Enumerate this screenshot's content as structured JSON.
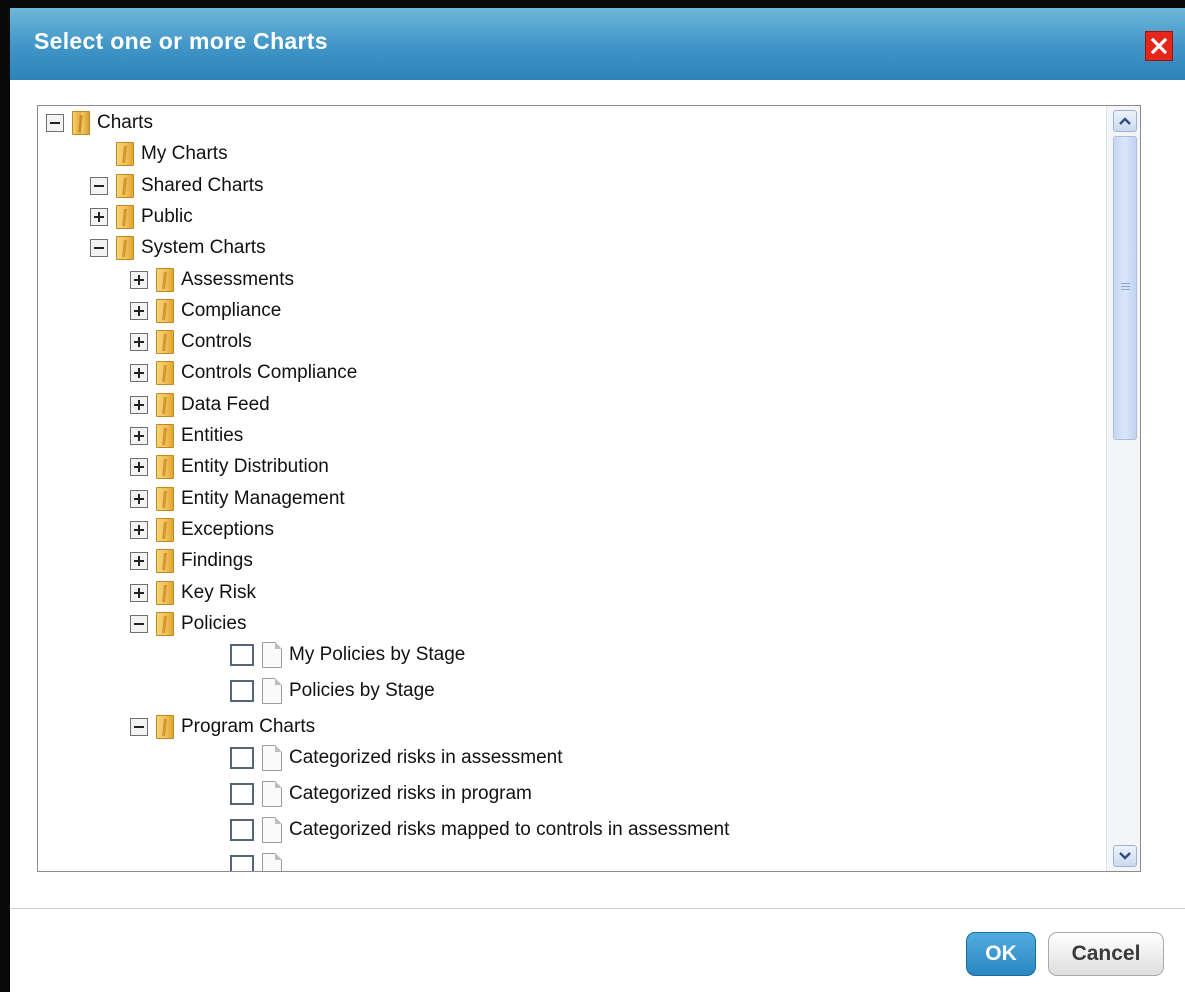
{
  "dialog": {
    "title": "Select one or more Charts",
    "ok_label": "OK",
    "cancel_label": "Cancel"
  },
  "tree": [
    {
      "label": "Charts",
      "kind": "folder",
      "toggle": "minus",
      "level": 0
    },
    {
      "label": "My Charts",
      "kind": "folder",
      "toggle": "none",
      "level": 1
    },
    {
      "label": "Shared Charts",
      "kind": "folder",
      "toggle": "minus",
      "level": 1
    },
    {
      "label": "Public",
      "kind": "folder",
      "toggle": "plus",
      "level": 2
    },
    {
      "label": "System Charts",
      "kind": "folder",
      "toggle": "minus",
      "level": 2
    },
    {
      "label": "Assessments",
      "kind": "folder",
      "toggle": "plus",
      "level": 3
    },
    {
      "label": "Compliance",
      "kind": "folder",
      "toggle": "plus",
      "level": 3
    },
    {
      "label": "Controls",
      "kind": "folder",
      "toggle": "plus",
      "level": 3
    },
    {
      "label": "Controls Compliance",
      "kind": "folder",
      "toggle": "plus",
      "level": 3
    },
    {
      "label": "Data Feed",
      "kind": "folder",
      "toggle": "plus",
      "level": 3
    },
    {
      "label": "Entities",
      "kind": "folder",
      "toggle": "plus",
      "level": 3
    },
    {
      "label": "Entity Distribution",
      "kind": "folder",
      "toggle": "plus",
      "level": 3
    },
    {
      "label": "Entity Management",
      "kind": "folder",
      "toggle": "plus",
      "level": 3
    },
    {
      "label": "Exceptions",
      "kind": "folder",
      "toggle": "plus",
      "level": 3
    },
    {
      "label": "Findings",
      "kind": "folder",
      "toggle": "plus",
      "level": 3
    },
    {
      "label": "Key Risk",
      "kind": "folder",
      "toggle": "plus",
      "level": 3
    },
    {
      "label": "Policies",
      "kind": "folder",
      "toggle": "minus",
      "level": 3
    },
    {
      "label": "My Policies by Stage",
      "kind": "chart",
      "checked": false,
      "level": 4
    },
    {
      "label": "Policies by Stage",
      "kind": "chart",
      "checked": false,
      "level": 4
    },
    {
      "label": "Program Charts",
      "kind": "folder",
      "toggle": "minus",
      "level": 3
    },
    {
      "label": "Categorized risks in assessment",
      "kind": "chart",
      "checked": false,
      "level": 4
    },
    {
      "label": "Categorized risks in program",
      "kind": "chart",
      "checked": false,
      "level": 4
    },
    {
      "label": "Categorized risks mapped to controls in assessment",
      "kind": "chart",
      "checked": false,
      "level": 4
    },
    {
      "label": "",
      "kind": "chart",
      "checked": false,
      "level": 4
    }
  ]
}
